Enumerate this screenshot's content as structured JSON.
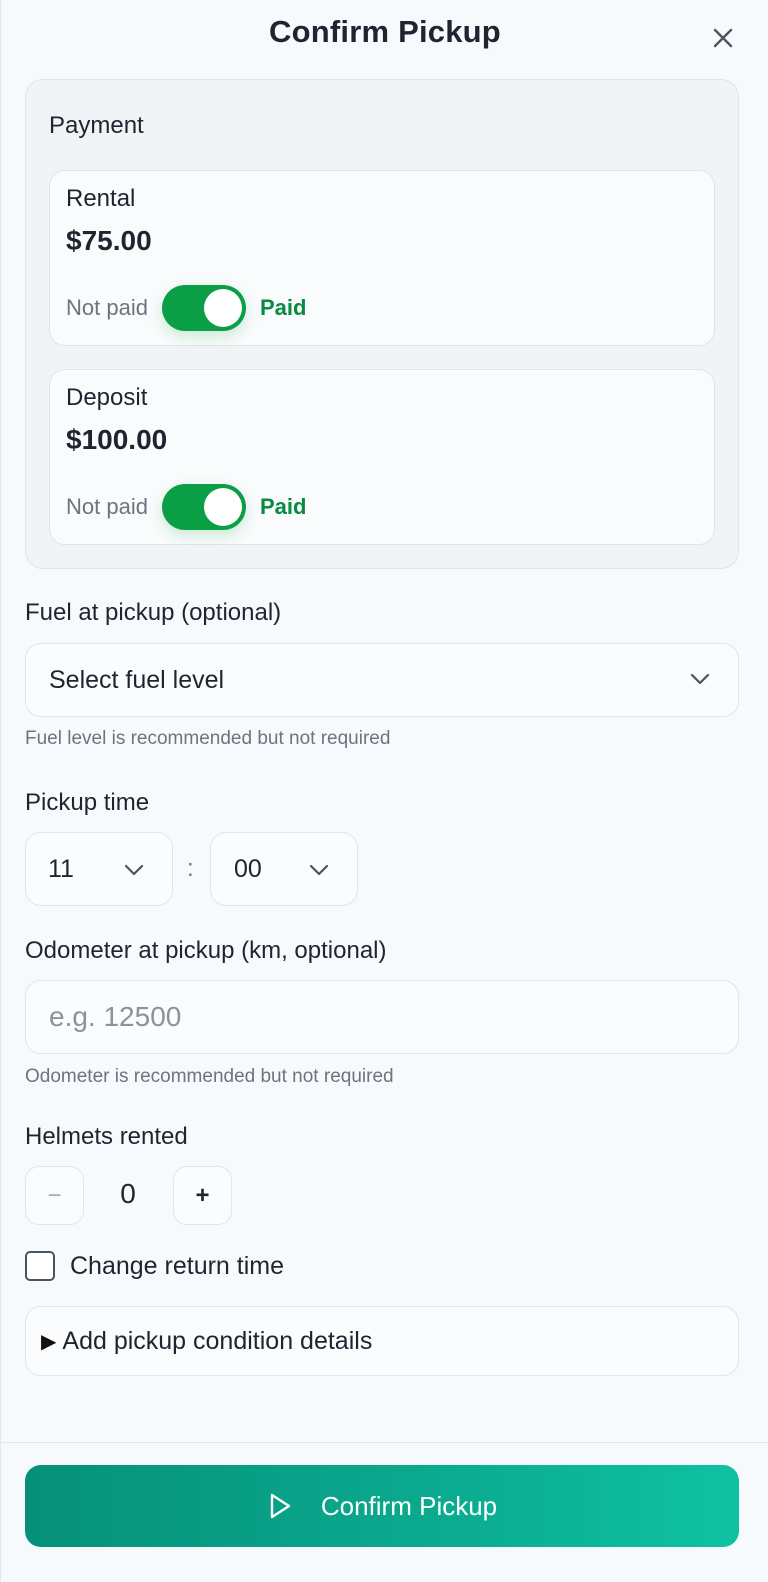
{
  "header": {
    "title": "Confirm Pickup",
    "close_icon": "close-icon"
  },
  "payment": {
    "title": "Payment",
    "items": [
      {
        "label": "Rental",
        "amount": "$75.00",
        "off_label": "Not paid",
        "on_label": "Paid",
        "paid": true
      },
      {
        "label": "Deposit",
        "amount": "$100.00",
        "off_label": "Not paid",
        "on_label": "Paid",
        "paid": true
      }
    ]
  },
  "fuel": {
    "label": "Fuel at pickup (optional)",
    "value": "Select fuel level",
    "hint": "Fuel level is recommended but not required"
  },
  "pickup_time": {
    "label": "Pickup time",
    "hour": "11",
    "separator": ":",
    "minute": "00"
  },
  "odometer": {
    "label": "Odometer at pickup (km, optional)",
    "placeholder": "e.g. 12500",
    "value": "",
    "hint": "Odometer is recommended but not required"
  },
  "helmets": {
    "label": "Helmets rented",
    "minus": "−",
    "value": "0",
    "plus": "+"
  },
  "return_time": {
    "label": "Change return time",
    "checked": false
  },
  "condition": {
    "marker": "▶",
    "label": "Add pickup condition details"
  },
  "footer": {
    "confirm_label": "Confirm Pickup",
    "confirm_icon": "play-icon"
  },
  "colors": {
    "toggle_on": "#0a9e45",
    "paid_text": "#0a8a40",
    "button_gradient_start": "#069079",
    "button_gradient_end": "#0fc1a2"
  }
}
